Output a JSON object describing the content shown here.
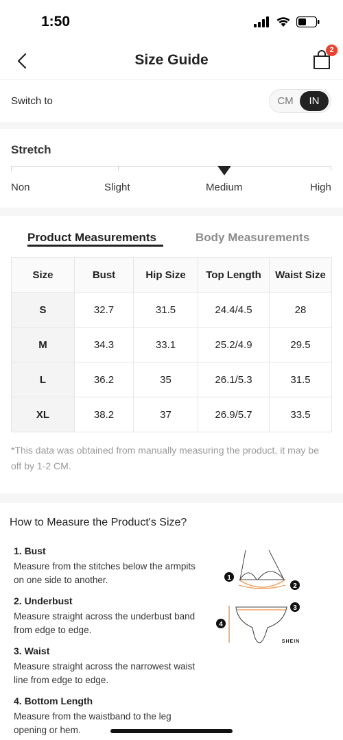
{
  "status": {
    "time": "1:50"
  },
  "nav": {
    "title": "Size Guide",
    "cart_count": "2"
  },
  "switch": {
    "label": "Switch to",
    "options": [
      "CM",
      "IN"
    ],
    "selected": "IN"
  },
  "stretch": {
    "title": "Stretch",
    "levels": [
      "Non",
      "Slight",
      "Medium",
      "High"
    ],
    "selected": "Medium"
  },
  "tabs": [
    "Product Measurements",
    "Body Measurements"
  ],
  "active_tab": "Product Measurements",
  "table": {
    "headers": [
      "Size",
      "Bust",
      "Hip Size",
      "Top Length",
      "Waist Size"
    ],
    "rows": [
      [
        "S",
        "32.7",
        "31.5",
        "24.4/4.5",
        "28"
      ],
      [
        "M",
        "34.3",
        "33.1",
        "25.2/4.9",
        "29.5"
      ],
      [
        "L",
        "36.2",
        "35",
        "26.1/5.3",
        "31.5"
      ],
      [
        "XL",
        "38.2",
        "37",
        "26.9/5.7",
        "33.5"
      ]
    ]
  },
  "note": "*This data was obtained from manually measuring the product, it may be off by 1-2 CM.",
  "howto": {
    "title": "How to Measure the Product's Size?",
    "steps": [
      {
        "title": "1. Bust",
        "desc": "Measure from the stitches below the armpits on one side to another."
      },
      {
        "title": "2. Underbust",
        "desc": "Measure straight across the underbust band from edge to edge."
      },
      {
        "title": "3. Waist",
        "desc": "Measure straight across the narrowest waist line from edge to edge."
      },
      {
        "title": "4. Bottom Length",
        "desc": "Measure from the waistband to the leg opening or hem."
      }
    ],
    "illustration": {
      "brand": "SHEIN",
      "markers": [
        "1",
        "2",
        "3",
        "4"
      ]
    }
  },
  "colors": {
    "accent": "#222222",
    "badge": "#f0402d",
    "measure_line": "#f0a060"
  }
}
